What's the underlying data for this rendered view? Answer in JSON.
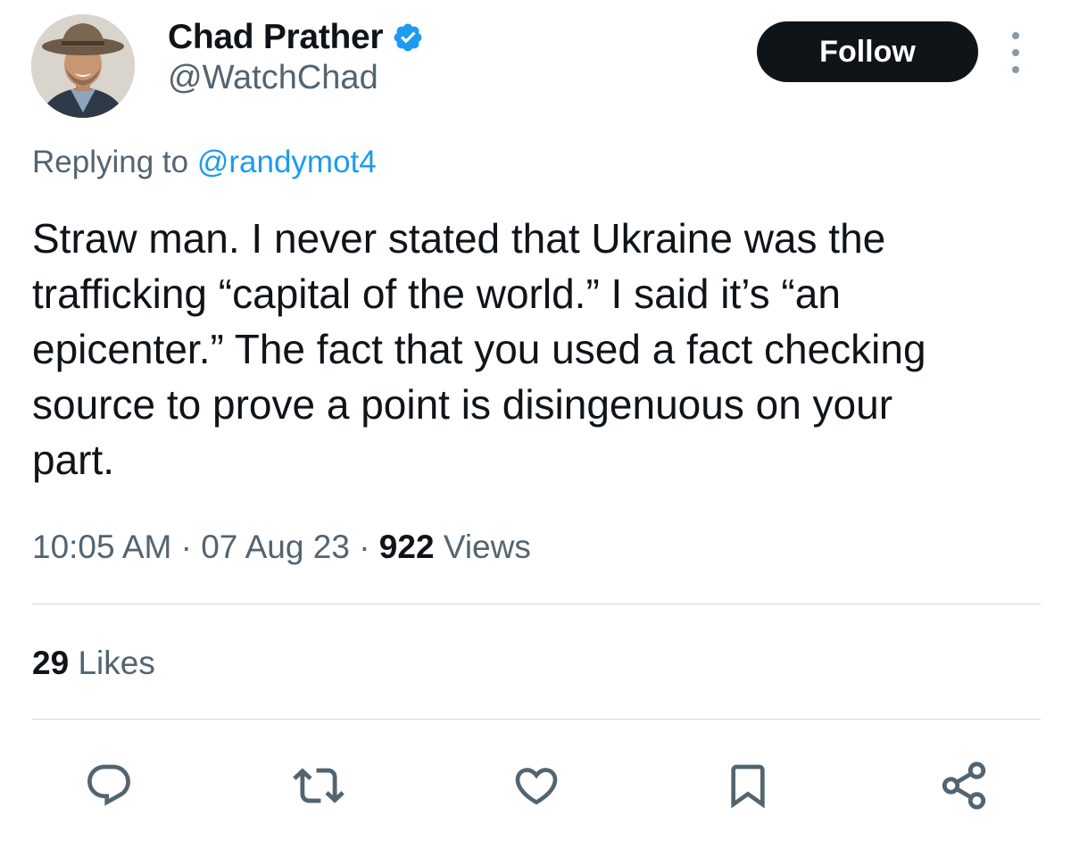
{
  "author": {
    "name": "Chad Prather",
    "handle": "@WatchChad",
    "verified_icon": "verified-badge-icon",
    "verified_color": "#1d9bf0"
  },
  "follow_label": "Follow",
  "reply_context": {
    "prefix": "Replying to",
    "mention": "@randymot4"
  },
  "tweet": {
    "text": "Straw man. I never stated that Ukraine was the\ntrafficking “capital of the world.” I said it’s “an\nepicenter.” The fact that you used a fact checking\nsource to prove a point is disingenuous on your\npart."
  },
  "meta": {
    "time": "10:05 AM",
    "separator": "·",
    "date": "07 Aug 23",
    "views_count": "922",
    "views_label": "Views"
  },
  "engagement": {
    "likes_count": "29",
    "likes_label": "Likes"
  },
  "actions": [
    {
      "icon": "reply-icon"
    },
    {
      "icon": "retweet-icon"
    },
    {
      "icon": "like-icon"
    },
    {
      "icon": "bookmark-icon"
    },
    {
      "icon": "share-icon"
    }
  ],
  "colors": {
    "text": "#0f1419",
    "secondary": "#536471",
    "accent": "#1d9bf0",
    "divider": "#cfd9de",
    "button": "#0f1419"
  }
}
